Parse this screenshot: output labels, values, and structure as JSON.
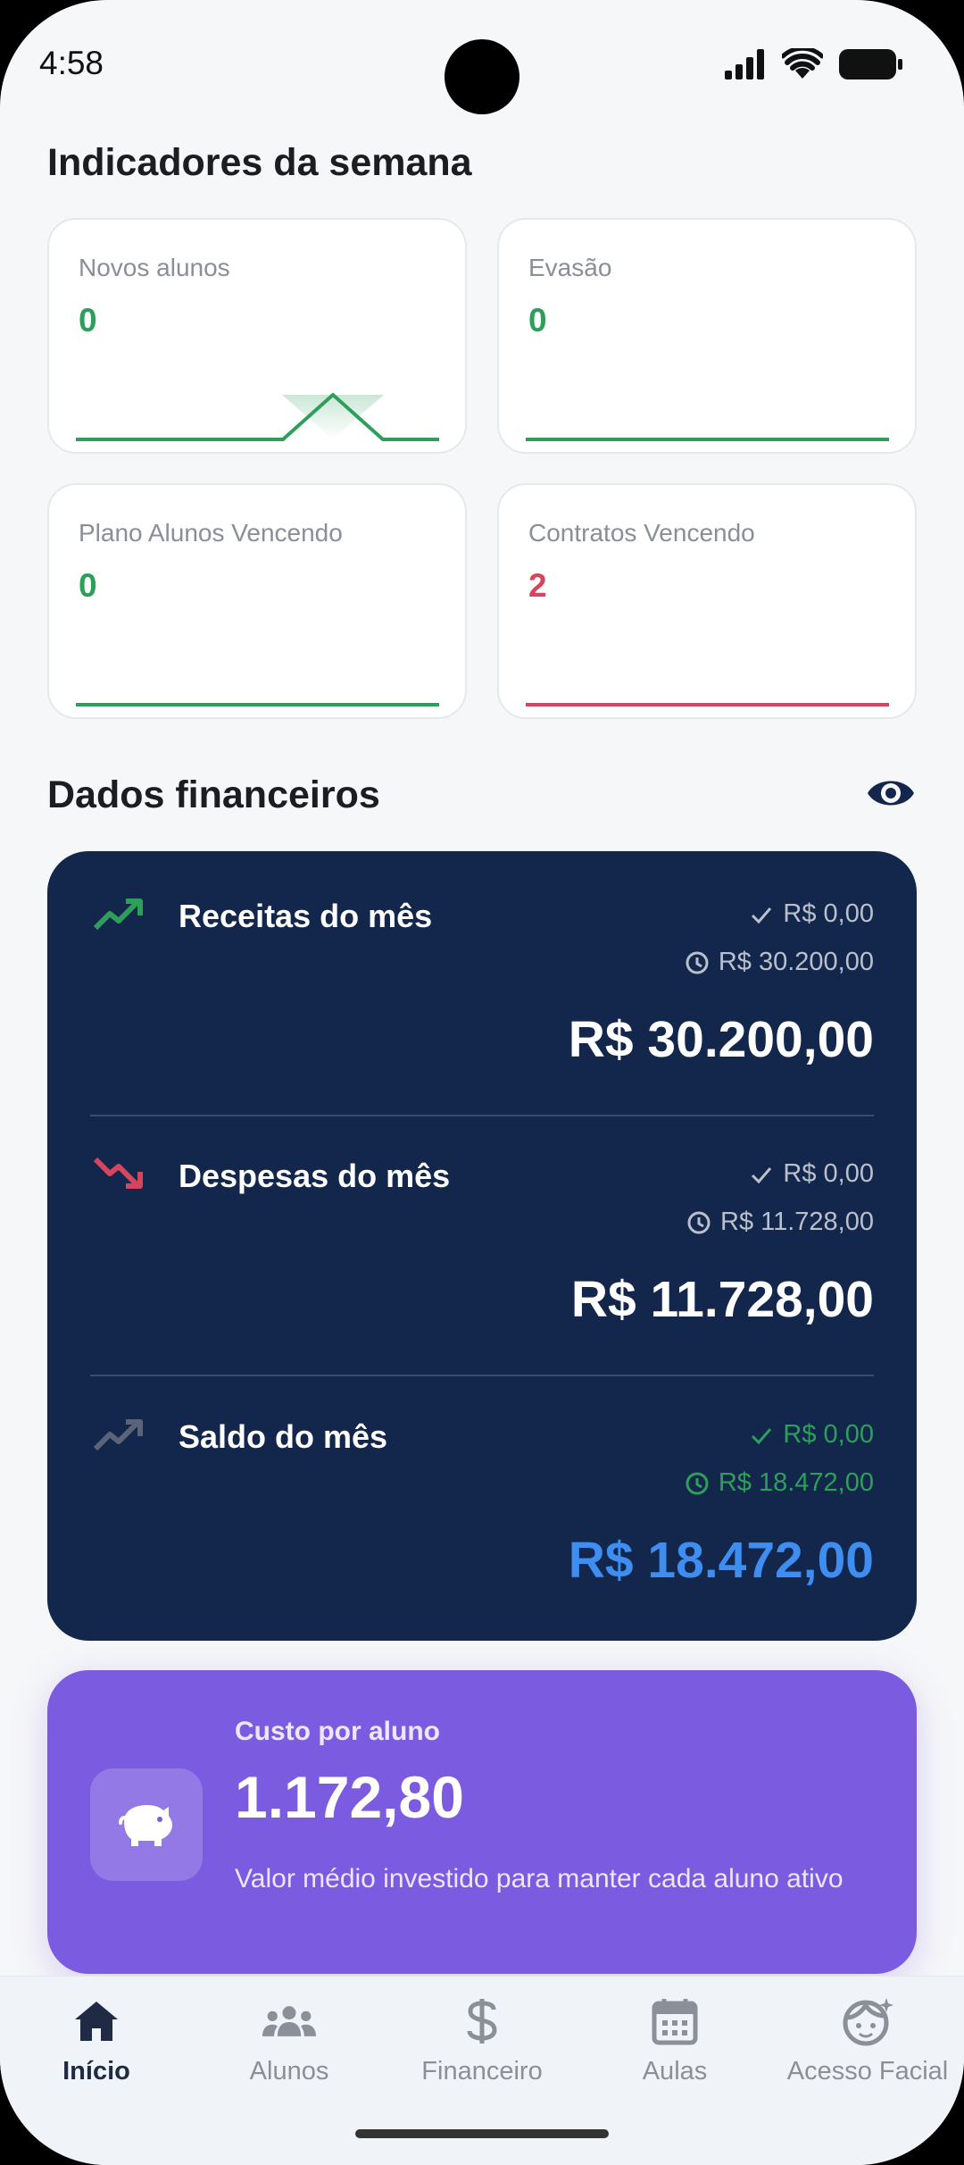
{
  "status_bar": {
    "time": "4:58"
  },
  "indicators": {
    "title": "Indicadores da semana",
    "cards": [
      {
        "label": "Novos alunos",
        "value": "0",
        "color": "#2e9e5b"
      },
      {
        "label": "Evasão",
        "value": "0",
        "color": "#2e9e5b"
      },
      {
        "label": "Plano Alunos Vencendo",
        "value": "0",
        "color": "#2e9e5b"
      },
      {
        "label": "Contratos Vencendo",
        "value": "2",
        "color": "#d6455d"
      }
    ]
  },
  "finance": {
    "title": "Dados financeiros",
    "rows": [
      {
        "title": "Receitas do mês",
        "paid": "R$ 0,00",
        "pending": "R$ 30.200,00",
        "total": "R$ 30.200,00"
      },
      {
        "title": "Despesas do mês",
        "paid": "R$ 0,00",
        "pending": "R$ 11.728,00",
        "total": "R$ 11.728,00"
      },
      {
        "title": "Saldo do mês",
        "paid": "R$ 0,00",
        "pending": "R$ 18.472,00",
        "total": "R$ 18.472,00"
      }
    ],
    "colors": {
      "card_bg": "#13274c",
      "income": "#2e9e5b",
      "expense": "#d6455d",
      "balance_total": "#3d8ef0"
    }
  },
  "cost_per_student": {
    "label": "Custo por aluno",
    "value": "1.172,80",
    "description": "Valor médio investido para manter cada aluno ativo",
    "color": "#7b5ce1"
  },
  "bottom_nav": {
    "items": [
      {
        "label": "Início",
        "icon": "home-icon",
        "active": true
      },
      {
        "label": "Alunos",
        "icon": "people-icon",
        "active": false
      },
      {
        "label": "Financeiro",
        "icon": "dollar-icon",
        "active": false
      },
      {
        "label": "Aulas",
        "icon": "calendar-icon",
        "active": false
      },
      {
        "label": "Acesso Facial",
        "icon": "face-icon",
        "active": false
      }
    ]
  }
}
